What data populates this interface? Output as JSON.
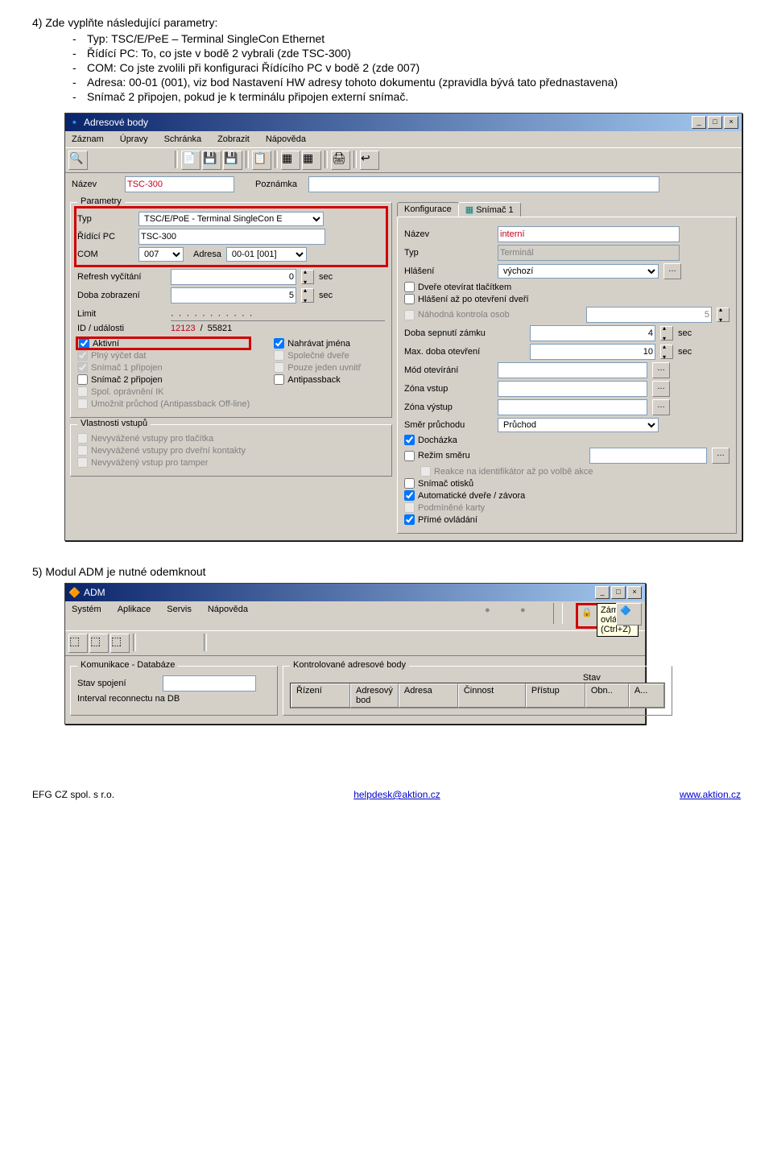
{
  "doc": {
    "step4_num": "4)",
    "step4_title": "Zde vyplňte následující parametry:",
    "bullets": [
      "Typ: TSC/E/PeE – Terminal SingleCon Ethernet",
      "Řídící PC: To, co jste v bodě 2 vybrali (zde TSC-300)",
      "COM: Co jste zvolili při konfiguraci Řídícího PC v bodě 2 (zde 007)",
      "Adresa: 00-01 (001), viz bod Nastavení HW adresy tohoto dokumentu (zpravidla bývá tato přednastavena)",
      "Snímač 2 připojen, pokud je k terminálu připojen externí snímač."
    ],
    "step5_num": "5)",
    "step5_title": "Modul ADM je nutné odemknout"
  },
  "win1": {
    "title": "Adresové body",
    "menus": [
      "Záznam",
      "Úpravy",
      "Schránka",
      "Zobrazit",
      "Nápověda"
    ],
    "nazev_lbl": "Název",
    "nazev_val": "TSC-300",
    "poznamka_lbl": "Poznámka",
    "params_legend": "Parametry",
    "typ_lbl": "Typ",
    "typ_val": "TSC/E/PoE - Terminal SingleCon E",
    "ridici_lbl": "Řídící PC",
    "ridici_val": "TSC-300",
    "com_lbl": "COM",
    "com_val": "007",
    "adresa_lbl": "Adresa",
    "adresa_val": "00-01 [001]",
    "refresh_lbl": "Refresh vyčítání",
    "refresh_val": "0",
    "sec": "sec",
    "doba_lbl": "Doba zobrazení",
    "doba_val": "5",
    "limit_lbl": "Limit",
    "id_udal_lbl": "ID / události",
    "id_val": "12123",
    "id_sep": "/",
    "id_val2": "55821",
    "chk_aktivni": "Aktivní",
    "chk_plny": "Plný výčet dat",
    "chk_snimac1": "Snímač 1 připojen",
    "chk_snimac2": "Snímač 2 připojen",
    "chk_spol": "Spol. oprávnění IK",
    "chk_umoznit": "Umožnit průchod (Antipassback Off-line)",
    "chk_nahravat": "Nahrávat jména",
    "chk_spolecne": "Společné dveře",
    "chk_pouze": "Pouze jeden uvnitř",
    "chk_antipass": "Antipassback",
    "vlast_legend": "Vlastnosti vstupů",
    "chk_v1": "Nevyvážené vstupy pro tlačítka",
    "chk_v2": "Nevyvážené vstupy pro dveřní kontakty",
    "chk_v3": "Nevyvážený vstup pro tamper",
    "tab_konf": "Konfigurace",
    "tab_snimac": "Snímač 1",
    "s_nazev_lbl": "Název",
    "s_nazev_val": "interní",
    "s_typ_lbl": "Typ",
    "s_typ_val": "Terminál",
    "s_hlaseni_lbl": "Hlášení",
    "s_hlaseni_val": "výchozí",
    "chk_dvere_tl": "Dveře otevírat tlačítkem",
    "chk_hlaseni_po": "Hlášení až po otevření dveří",
    "chk_nahodna": "Náhodná kontrola osob",
    "nahodna_val": "5",
    "doba_sepnuti_lbl": "Doba sepnutí zámku",
    "doba_sepnuti_val": "4",
    "max_doba_lbl": "Max. doba otevření",
    "max_doba_val": "10",
    "mod_lbl": "Mód otevírání",
    "zona_vstup_lbl": "Zóna vstup",
    "zona_vystup_lbl": "Zóna výstup",
    "smer_lbl": "Směr průchodu",
    "smer_val": "Průchod",
    "chk_dochazka": "Docházka",
    "chk_rezim": "Režim směru",
    "chk_reakce": "Reakce na identifikátor až po volbě akce",
    "chk_otisk": "Snímač otisků",
    "chk_auto": "Automatické dveře / závora",
    "chk_podminene": "Podmíněné karty",
    "chk_prime": "Přímé ovládání"
  },
  "win2": {
    "title": "ADM",
    "menus": [
      "Systém",
      "Aplikace",
      "Servis",
      "Nápověda"
    ],
    "tooltip": "Zámek ovládání (Ctrl+Z)",
    "kom_legend": "Komunikace - Databáze",
    "stav_spojeni_lbl": "Stav spojení",
    "interval_lbl": "Interval reconnectu na DB",
    "kontrol_legend": "Kontrolované adresové body",
    "cols": [
      "Řízení",
      "Adresový bod",
      "Adresa",
      "Činnost",
      "Stav",
      "Přístup",
      "Obn..",
      "A..."
    ]
  },
  "footer": {
    "left": "EFG CZ spol. s r.o.",
    "mid": "helpdesk@aktion.cz",
    "right": "www.aktion.cz"
  }
}
